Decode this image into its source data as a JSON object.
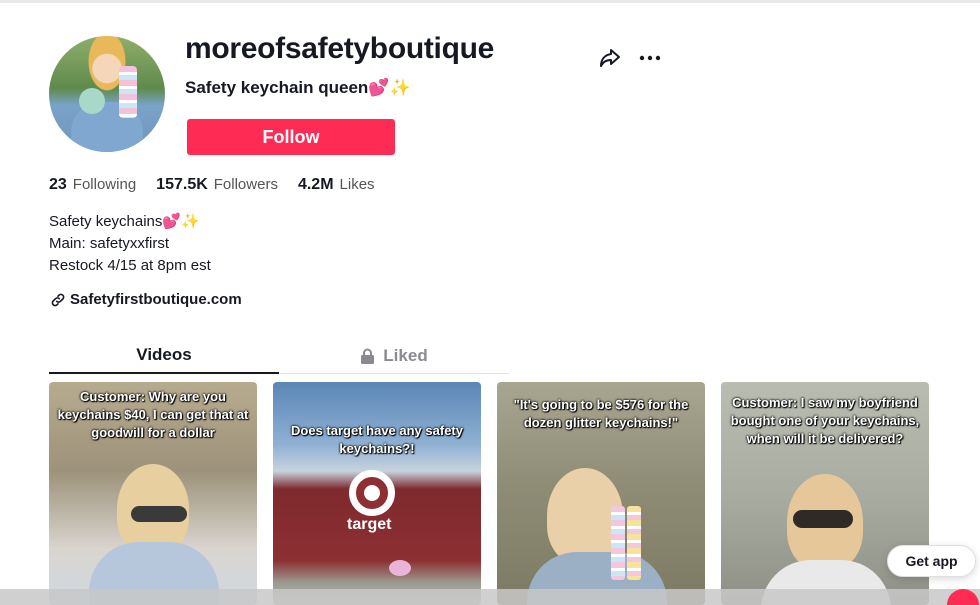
{
  "profile": {
    "username": "moreofsafetyboutique",
    "subtitle": "Safety keychain queen💕✨",
    "follow_label": "Follow"
  },
  "stats": {
    "following_count": "23",
    "following_label": "Following",
    "followers_count": "157.5K",
    "followers_label": "Followers",
    "likes_count": "4.2M",
    "likes_label": "Likes"
  },
  "bio": {
    "line1": "Safety keychains💕✨",
    "line2": "Main: safetyxxfirst",
    "line3": "Restock 4/15 at 8pm est"
  },
  "link": {
    "text": "Safetyfirstboutique.com"
  },
  "tabs": {
    "videos": "Videos",
    "liked": "Liked"
  },
  "videos": [
    {
      "caption": "Customer: Why are you keychains $40, I can get that at goodwill for a dollar"
    },
    {
      "caption": "Does target have any safety keychains?!",
      "sign_text": "target"
    },
    {
      "caption": "\"It's going to be $576 for the dozen glitter keychains!\""
    },
    {
      "caption": "Customer: I saw my boyfriend bought one of your keychains, when will it be delivered?"
    }
  ],
  "get_app_label": "Get app",
  "colors": {
    "accent": "#fe2c55",
    "text_primary": "#161823",
    "text_secondary": "#8a8b91"
  },
  "icons": [
    "share-icon",
    "more-icon",
    "link-icon",
    "lock-icon"
  ]
}
